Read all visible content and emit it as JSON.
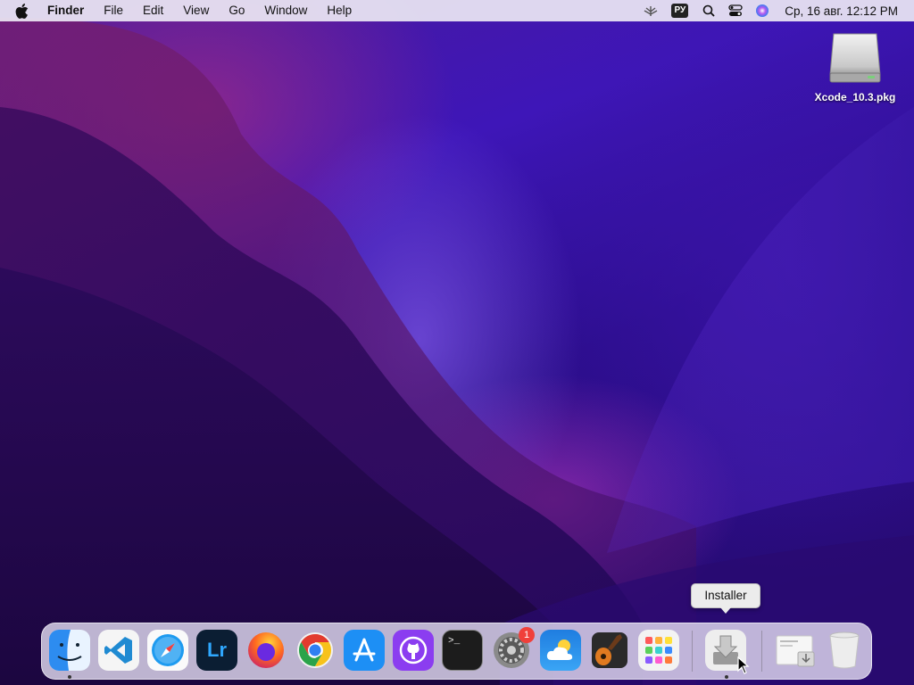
{
  "menubar": {
    "app_name": "Finder",
    "menus": [
      "File",
      "Edit",
      "View",
      "Go",
      "Window",
      "Help"
    ],
    "language": "РУ",
    "datetime": "Ср, 16 авг.  12:12 PM"
  },
  "desktop": {
    "items": [
      {
        "label": "Xcode_10.3.pkg",
        "icon": "disk-image-icon"
      }
    ]
  },
  "tooltip": {
    "text": "Installer"
  },
  "dock": {
    "apps": [
      {
        "name": "Finder",
        "icon": "finder-icon",
        "running": true
      },
      {
        "name": "Visual Studio Code",
        "icon": "vscode-icon",
        "running": false
      },
      {
        "name": "Safari",
        "icon": "safari-icon",
        "running": false
      },
      {
        "name": "Lightroom",
        "icon": "lightroom-icon",
        "label": "Lr",
        "running": false
      },
      {
        "name": "Firefox",
        "icon": "firefox-icon",
        "running": false
      },
      {
        "name": "Chrome",
        "icon": "chrome-icon",
        "running": false
      },
      {
        "name": "App Store",
        "icon": "app-store-icon",
        "running": false
      },
      {
        "name": "GitHub Desktop",
        "icon": "github-icon",
        "running": false
      },
      {
        "name": "Terminal",
        "icon": "terminal-icon",
        "label": ">_",
        "running": false
      },
      {
        "name": "System Preferences",
        "icon": "system-preferences-icon",
        "badge": "1",
        "running": false
      },
      {
        "name": "Weather",
        "icon": "weather-icon",
        "running": false
      },
      {
        "name": "GarageBand",
        "icon": "garageband-icon",
        "running": false
      },
      {
        "name": "Launchpad",
        "icon": "launchpad-icon",
        "running": false
      }
    ],
    "recent": [
      {
        "name": "Installer",
        "icon": "installer-icon",
        "running": true
      }
    ],
    "extras": [
      {
        "name": "Downloads",
        "icon": "downloads-stack-icon"
      },
      {
        "name": "Trash",
        "icon": "trash-icon"
      }
    ]
  },
  "colors": {
    "menubar_bg": "#ECE8F4",
    "wallpaper_primary": "#3E16B8",
    "badge_red": "#F0403A"
  }
}
